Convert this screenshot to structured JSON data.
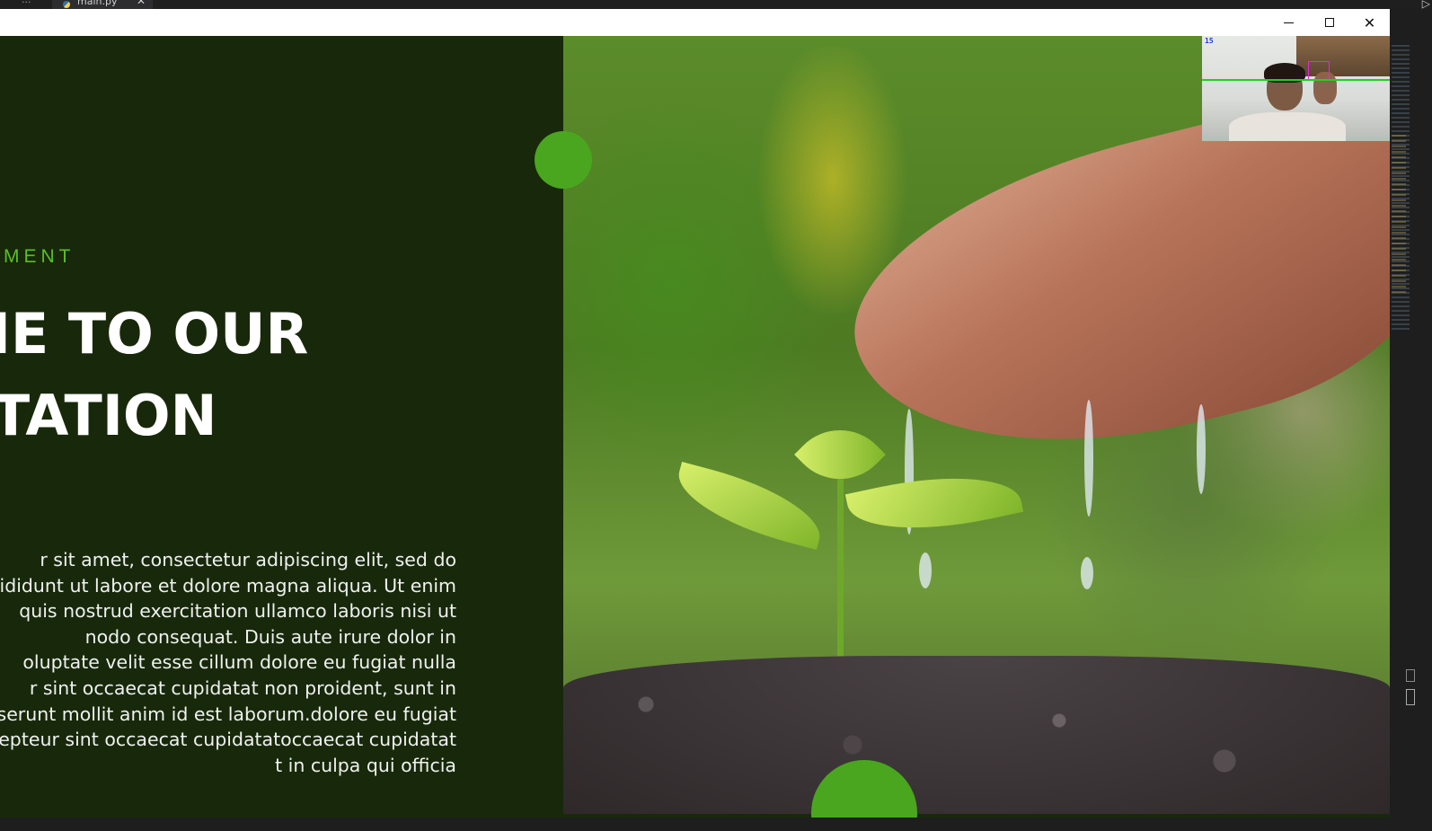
{
  "editor": {
    "tab_label": "main.py",
    "overflow_glyph": "···",
    "close_glyph": "✕",
    "run_glyph": "▷"
  },
  "window": {
    "minimize_label": "",
    "maximize_label": "",
    "close_glyph": "✕"
  },
  "slide": {
    "kicker": "NTMENT",
    "headline_line1": "COME TO OUR",
    "headline_line2": "SENTATION",
    "body_lines": [
      "r sit amet, consectetur adipiscing elit, sed do",
      "ncididunt ut labore et dolore magna aliqua. Ut enim",
      "quis nostrud exercitation ullamco laboris nisi ut",
      "nodo consequat. Duis aute irure dolor in",
      "oluptate velit esse cillum dolore eu fugiat nulla",
      "r sint occaecat cupidatat non proident, sunt in",
      "eserunt mollit anim id est laborum.dolore eu fugiat",
      "epteur sint occaecat cupidatatoccaecat cupidatat",
      "t in culpa qui officia"
    ]
  },
  "webcam": {
    "fps": "15"
  },
  "colors": {
    "panel_bg": "#17290a",
    "accent_green": "#4aa61f",
    "kicker_green": "#5bbf25"
  }
}
